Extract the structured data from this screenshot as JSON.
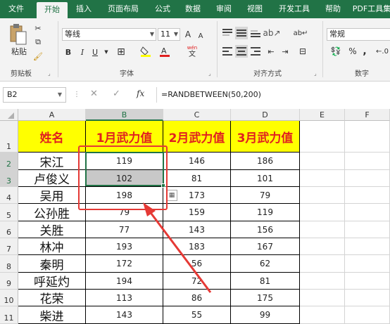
{
  "tabs": [
    "文件",
    "开始",
    "插入",
    "页面布局",
    "公式",
    "数据",
    "审阅",
    "视图",
    "开发工具",
    "帮助",
    "PDF工具集"
  ],
  "active_tab_index": 1,
  "ribbon": {
    "clipboard": {
      "paste_label": "粘贴",
      "group_label": "剪贴板"
    },
    "font": {
      "name": "等线",
      "size": "11",
      "grow": "A",
      "shrink": "A",
      "bold": "B",
      "italic": "I",
      "underline": "U",
      "wen": "wén",
      "wen_char": "文",
      "group_label": "字体"
    },
    "align": {
      "group_label": "对齐方式"
    },
    "number": {
      "format": "常规",
      "percent": "%",
      "comma": ",",
      "group_label": "数字"
    }
  },
  "formula_bar": {
    "name_box": "B2",
    "cancel": "✕",
    "enter": "✓",
    "fx": "fx",
    "formula": "=RANDBETWEEN(50,200)"
  },
  "columns": [
    "A",
    "B",
    "C",
    "D",
    "E",
    "F"
  ],
  "rows": [
    "1",
    "2",
    "3",
    "4",
    "5",
    "6",
    "7",
    "8",
    "9",
    "10",
    "11"
  ],
  "headers": [
    "姓名",
    "1月武力值",
    "2月武力值",
    "3月武力值"
  ],
  "table": [
    [
      "宋江",
      "119",
      "146",
      "186"
    ],
    [
      "卢俊义",
      "102",
      "81",
      "101"
    ],
    [
      "吴用",
      "198",
      "173",
      "79"
    ],
    [
      "公孙胜",
      "79",
      "159",
      "119"
    ],
    [
      "关胜",
      "77",
      "143",
      "156"
    ],
    [
      "林冲",
      "193",
      "183",
      "167"
    ],
    [
      "秦明",
      "172",
      "56",
      "62"
    ],
    [
      "呼延灼",
      "194",
      "72",
      "81"
    ],
    [
      "花荣",
      "113",
      "86",
      "175"
    ],
    [
      "柴进",
      "143",
      "55",
      "99"
    ]
  ],
  "colors": {
    "accent": "#217346",
    "header_fill": "#ffff00",
    "header_text": "#e02020",
    "annotation": "#e53935"
  }
}
